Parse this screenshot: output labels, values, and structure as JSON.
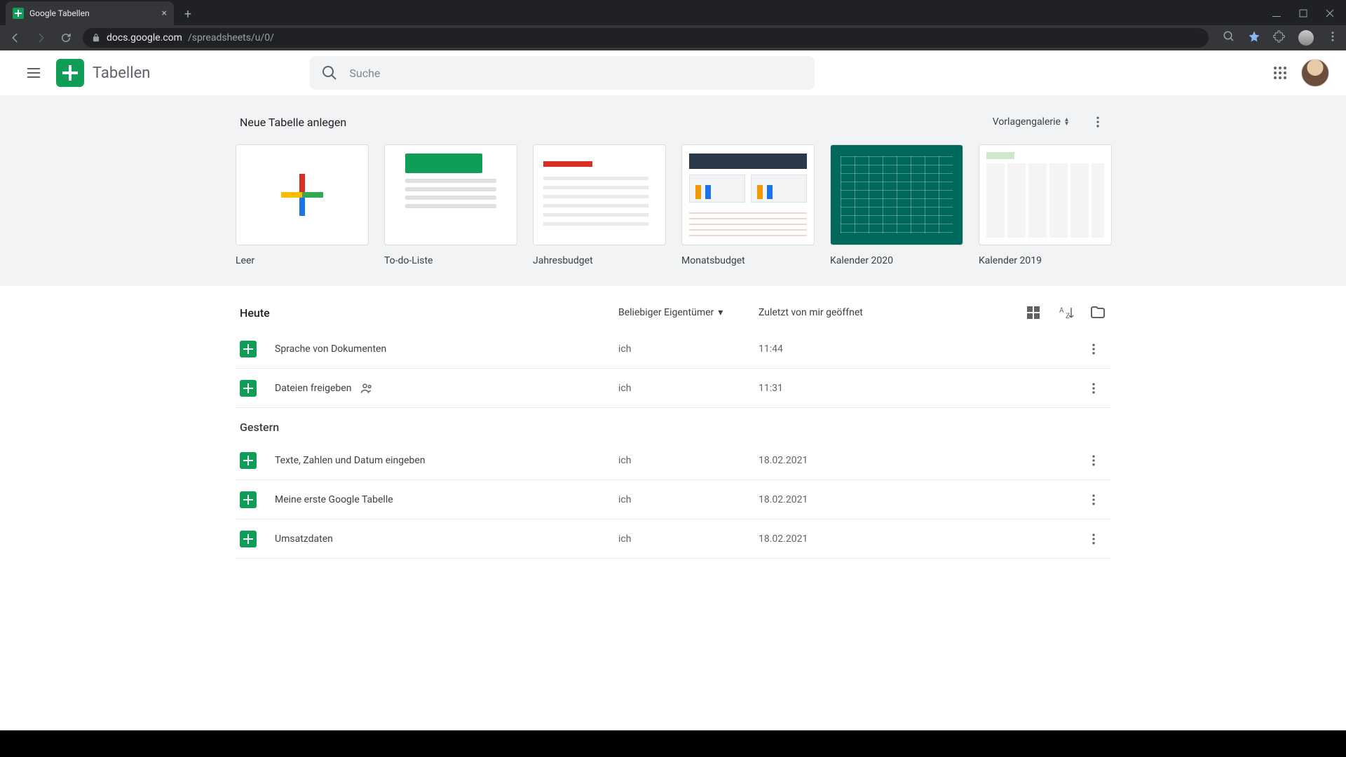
{
  "browser": {
    "tab_title": "Google Tabellen",
    "url_host": "docs.google.com",
    "url_path": "/spreadsheets/u/0/"
  },
  "topbar": {
    "app_title": "Tabellen",
    "search_placeholder": "Suche"
  },
  "templates": {
    "heading": "Neue Tabelle anlegen",
    "gallery_label": "Vorlagengalerie",
    "items": [
      {
        "label": "Leer"
      },
      {
        "label": "To-do-Liste"
      },
      {
        "label": "Jahresbudget"
      },
      {
        "label": "Monatsbudget"
      },
      {
        "label": "Kalender 2020"
      },
      {
        "label": "Kalender 2019"
      }
    ]
  },
  "filters": {
    "owner_label": "Beliebiger Eigentümer",
    "sort_label": "Zuletzt von mir geöffnet"
  },
  "groups": [
    {
      "heading": "Heute",
      "docs": [
        {
          "name": "Sprache von Dokumenten",
          "owner": "ich",
          "time": "11:44",
          "shared": false
        },
        {
          "name": "Dateien freigeben",
          "owner": "ich",
          "time": "11:31",
          "shared": true
        }
      ]
    },
    {
      "heading": "Gestern",
      "docs": [
        {
          "name": "Texte, Zahlen und Datum eingeben",
          "owner": "ich",
          "time": "18.02.2021",
          "shared": false
        },
        {
          "name": "Meine erste Google Tabelle",
          "owner": "ich",
          "time": "18.02.2021",
          "shared": false
        },
        {
          "name": "Umsatzdaten",
          "owner": "ich",
          "time": "18.02.2021",
          "shared": false
        }
      ]
    }
  ]
}
